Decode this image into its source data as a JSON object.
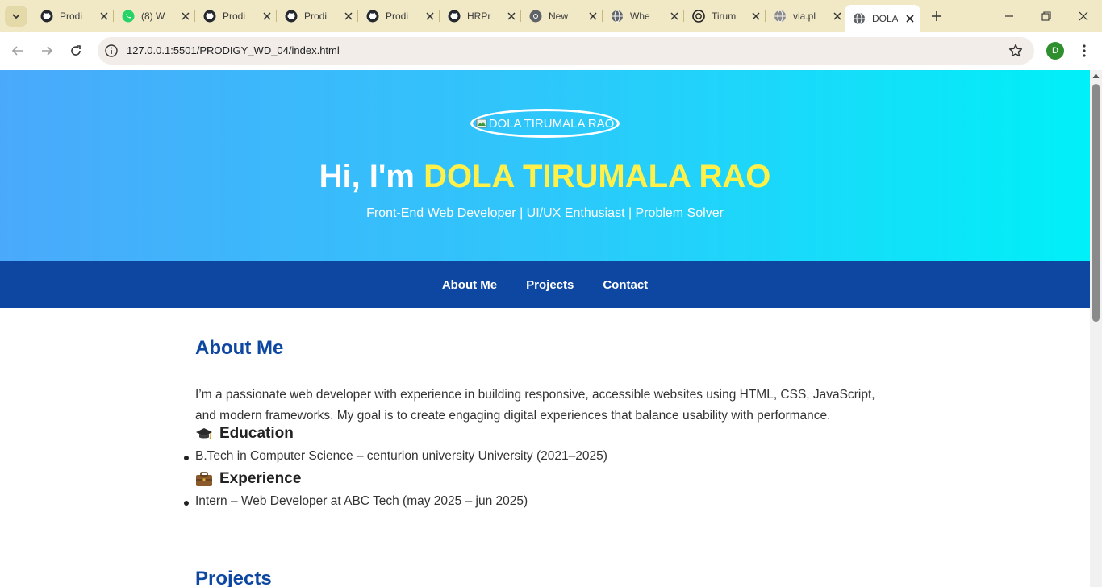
{
  "browser": {
    "tabs": [
      {
        "title": "Prodi",
        "icon": "github-icon"
      },
      {
        "title": "(8) W",
        "icon": "whatsapp-icon"
      },
      {
        "title": "Prodi",
        "icon": "github-icon"
      },
      {
        "title": "Prodi",
        "icon": "github-icon"
      },
      {
        "title": "Prodi",
        "icon": "github-icon"
      },
      {
        "title": "HRPr",
        "icon": "github-icon"
      },
      {
        "title": "New",
        "icon": "chrome-icon"
      },
      {
        "title": "Whe",
        "icon": "globe-icon"
      },
      {
        "title": "Tirum",
        "icon": "chatgpt-icon"
      },
      {
        "title": "via.pl",
        "icon": "globe-icon"
      },
      {
        "title": "DOLA",
        "icon": "globe-icon",
        "active": true
      }
    ],
    "url_host": "127.0.0.1",
    "url_rest": ":5501/PRODIGY_WD_04/index.html",
    "profile_initial": "D",
    "accent": "#2f8f2f"
  },
  "hero": {
    "avatar_alt": "DOLA TIRUMALA RAO",
    "greeting": "Hi, I'm ",
    "name": "DOLA TIRUMALA RAO",
    "tagline": "Front-End Web Developer | UI/UX Enthusiast | Problem Solver",
    "name_color": "#fff04a"
  },
  "nav": {
    "items": [
      "About Me",
      "Projects",
      "Contact"
    ],
    "bg": "#0d47a1"
  },
  "about": {
    "title": "About Me",
    "text": "I’m a passionate web developer with experience in building responsive, accessible websites using HTML, CSS, JavaScript, and modern frameworks. My goal is to create engaging digital experiences that balance usability with performance.",
    "education_title": "Education",
    "education_icon": "graduation-cap-icon",
    "education_items": [
      "B.Tech in Computer Science – centurion university University (2021–2025)"
    ],
    "experience_title": "Experience",
    "experience_icon": "briefcase-icon",
    "experience_items": [
      "Intern – Web Developer at ABC Tech (may 2025 – jun 2025)"
    ]
  },
  "projects": {
    "title": "Projects"
  }
}
